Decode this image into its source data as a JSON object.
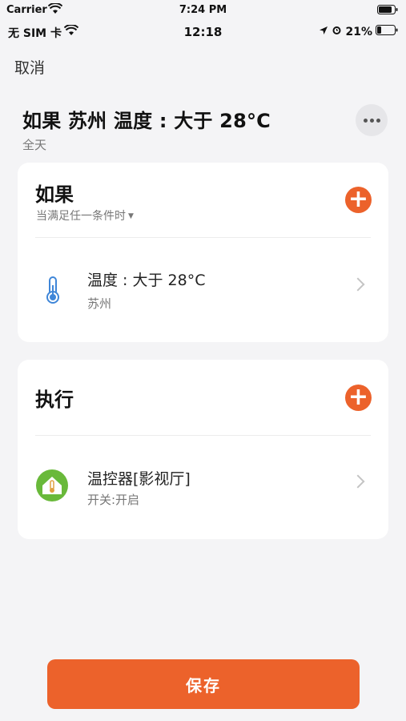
{
  "sim_status": {
    "carrier": "Carrier",
    "time": "7:24 PM"
  },
  "status": {
    "sim": "无 SIM 卡",
    "time": "12:18",
    "battery": "21%"
  },
  "nav": {
    "cancel": "取消"
  },
  "scene": {
    "title": "如果 苏州 温度 : 大于 28°C",
    "subtitle": "全天"
  },
  "if_section": {
    "title": "如果",
    "mode": "当满足任一条件时",
    "conditions": [
      {
        "title": "温度 : 大于 28°C",
        "sub": "苏州",
        "icon": "thermometer-icon"
      }
    ]
  },
  "then_section": {
    "title": "执行",
    "actions": [
      {
        "title": "温控器[影视厅]",
        "sub": "开关:开启",
        "icon": "thermostat-device-icon"
      }
    ]
  },
  "footer": {
    "save": "保存"
  },
  "colors": {
    "accent": "#ec622b",
    "thermo": "#3f86d8",
    "device_green": "#69b93a"
  }
}
